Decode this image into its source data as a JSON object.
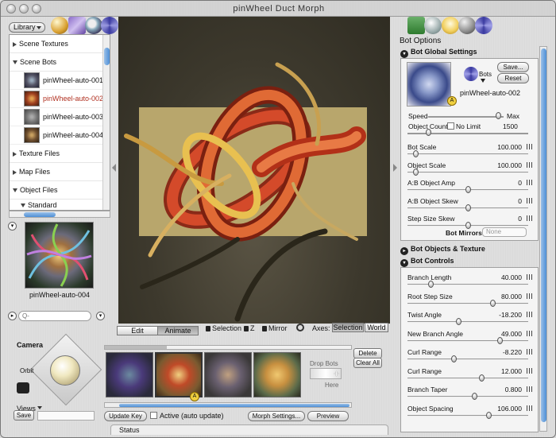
{
  "window": {
    "title": "pinWheel Duct Morph"
  },
  "library": {
    "button_label": "Library",
    "groups": [
      {
        "label": "Scene Textures",
        "expanded": false
      },
      {
        "label": "Scene Bots",
        "expanded": true
      }
    ],
    "bots": [
      {
        "name": "pinWheel-auto-001",
        "selected": false
      },
      {
        "name": "pinWheel-auto-002",
        "selected": true
      },
      {
        "name": "pinWheel-auto-003",
        "selected": false
      },
      {
        "name": "pinWheel-auto-004",
        "selected": false
      }
    ],
    "groups_after": [
      {
        "label": "Texture Files"
      },
      {
        "label": "Map Files"
      },
      {
        "label": "Object Files"
      }
    ],
    "sub_item": "Standard",
    "preview_label": "pinWheel-auto-004",
    "search_placeholder": "Q-"
  },
  "viewport_controls": {
    "tab_edit": "Edit",
    "tab_animate": "Animate",
    "lock_selection": "Selection",
    "lock_z": "Z",
    "lock_mirror": "Mirror",
    "axes_label": "Axes:",
    "axes_selection": "Selection",
    "axes_world": "World"
  },
  "timeline": {
    "drop_bots": "Drop Bots",
    "here": "Here",
    "delete_label": "Delete",
    "clear_all_label": "Clear All",
    "update_key_label": "Update Key",
    "active_label": "Active (auto update)",
    "morph_settings_label": "Morph Settings...",
    "preview_label": "Preview",
    "keyframe_marker": "A",
    "fill_fraction": 0.25
  },
  "camera": {
    "label": "Camera",
    "orbit_label": "Orbit",
    "views_label": "Views",
    "save_label": "Save"
  },
  "status": {
    "label": "Status"
  },
  "bot_options": {
    "title": "Bot Options",
    "global_settings": "Bot Global Settings",
    "save_label": "Save...",
    "reset_label": "Reset",
    "bots_menu": "Bots",
    "bot_name": "pinWheel-auto-002",
    "speed_label": "Speed",
    "speed_max": "Max",
    "object_count_label": "Object Count",
    "no_limit_label": "No Limit",
    "object_count_value": "1500",
    "global_params": [
      {
        "label": "Bot Scale",
        "value": "100.000",
        "pos": 0.05
      },
      {
        "label": "Object Scale",
        "value": "100.000",
        "pos": 0.05
      },
      {
        "label": "A:B Object Amp",
        "value": "0",
        "pos": 0.5
      },
      {
        "label": "A:B Object Skew",
        "value": "0",
        "pos": 0.5
      },
      {
        "label": "Step Size Skew",
        "value": "0",
        "pos": 0.5
      }
    ],
    "bot_mirrors_label": "Bot Mirrors:",
    "bot_mirrors_value": "None",
    "objects_texture": "Bot Objects & Texture",
    "controls": "Bot Controls",
    "control_params": [
      {
        "label": "Branch Length",
        "value": "40.000",
        "pos": 0.18
      },
      {
        "label": "Root Step Size",
        "value": "80.000",
        "pos": 0.72
      },
      {
        "label": "Twist Angle",
        "value": "-18.200",
        "pos": 0.42
      },
      {
        "label": "New Branch Angle",
        "value": "49.000",
        "pos": 0.78
      },
      {
        "label": "Curl Range",
        "value": "-8.220",
        "pos": 0.38
      },
      {
        "label": "Curl Range",
        "value": "12.000",
        "pos": 0.62
      },
      {
        "label": "Branch Taper",
        "value": "0.800",
        "pos": 0.56
      },
      {
        "label": "Object Spacing",
        "value": "106.000",
        "pos": 0.68
      }
    ]
  }
}
